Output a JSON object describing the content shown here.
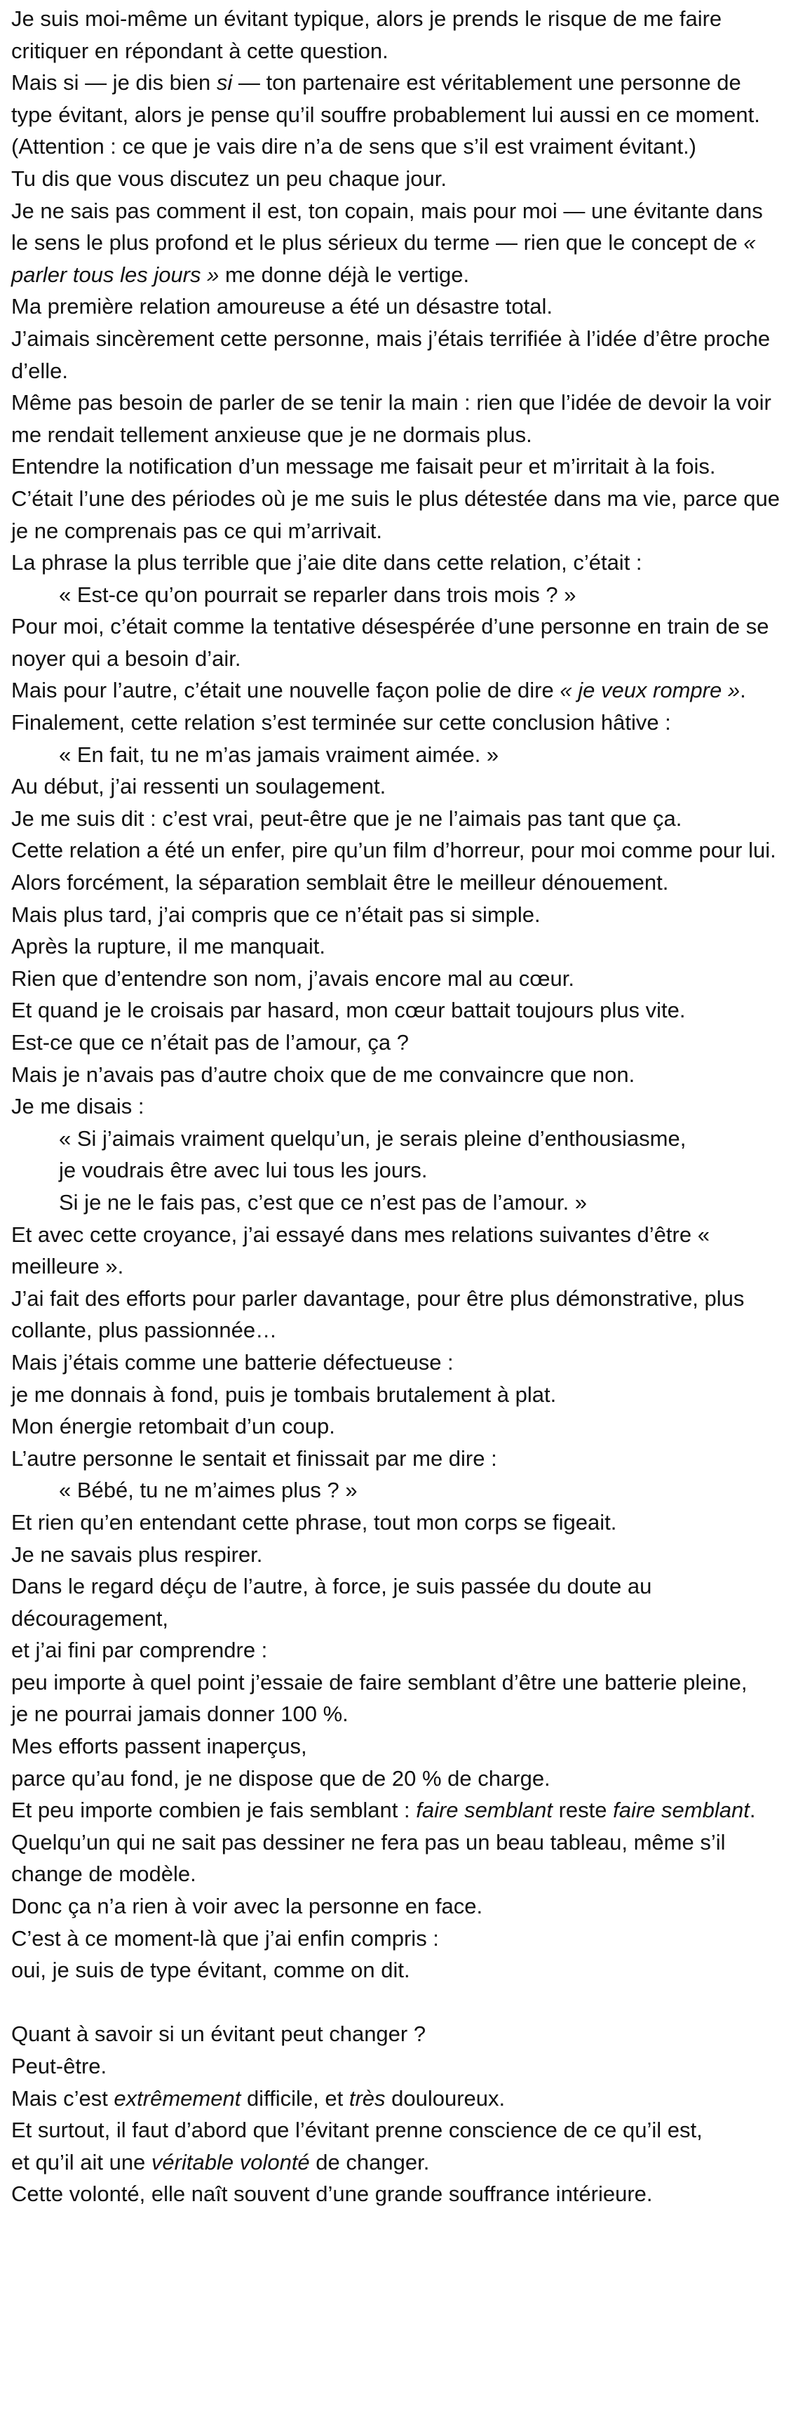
{
  "paragraphs": [
    {
      "id": "p1",
      "segments": [
        {
          "t": "Je suis moi-même un évitant typique, alors je prends le risque de me faire critiquer en répondant à cette question."
        }
      ]
    },
    {
      "id": "p2",
      "segments": [
        {
          "t": "Mais si — je dis bien "
        },
        {
          "t": "si",
          "i": true
        },
        {
          "t": " — ton partenaire est véritablement une personne de type évitant, alors je pense qu’il souffre probablement lui aussi en ce moment."
        }
      ]
    },
    {
      "id": "p3",
      "segments": [
        {
          "t": "(Attention : ce que je vais dire n’a de sens que s’il est vraiment évitant.)"
        }
      ]
    },
    {
      "id": "p4",
      "segments": [
        {
          "t": "Tu dis que vous discutez un peu chaque jour."
        }
      ]
    },
    {
      "id": "p5",
      "segments": [
        {
          "t": "Je ne sais pas comment il est, ton copain, mais pour moi — une évitante dans le sens le plus profond et le plus sérieux du terme — rien que le concept de "
        },
        {
          "t": "« parler tous les jours »",
          "i": true
        },
        {
          "t": " me donne déjà le vertige."
        }
      ]
    },
    {
      "id": "p6",
      "segments": [
        {
          "t": "Ma première relation amoureuse a été un désastre total."
        }
      ]
    },
    {
      "id": "p7",
      "segments": [
        {
          "t": "J’aimais sincèrement cette personne, mais j’étais terrifiée à l’idée d’être proche d’elle."
        }
      ]
    },
    {
      "id": "p8",
      "segments": [
        {
          "t": "Même pas besoin de parler de se tenir la main : rien que l’idée de devoir la voir me rendait tellement anxieuse que je ne dormais plus."
        }
      ]
    },
    {
      "id": "p9",
      "segments": [
        {
          "t": "Entendre la notification d’un message me faisait peur et m’irritait à la fois."
        }
      ]
    },
    {
      "id": "p10",
      "segments": [
        {
          "t": "C’était l’une des périodes où je me suis le plus détestée dans ma vie, parce que je ne comprenais pas ce qui m’arrivait."
        }
      ]
    },
    {
      "id": "p11",
      "segments": [
        {
          "t": "La phrase la plus terrible que j’aie dite dans cette relation, c’était :"
        }
      ]
    },
    {
      "id": "p12",
      "indent": true,
      "segments": [
        {
          "t": "« Est-ce qu’on pourrait se reparler dans trois mois ? »"
        }
      ]
    },
    {
      "id": "p13",
      "segments": [
        {
          "t": "Pour moi, c’était comme la tentative désespérée d’une personne en train de se noyer qui a besoin d’air."
        }
      ]
    },
    {
      "id": "p14",
      "segments": [
        {
          "t": "Mais pour l’autre, c’était une nouvelle façon polie de dire "
        },
        {
          "t": "« je veux rompre »",
          "i": true
        },
        {
          "t": "."
        }
      ]
    },
    {
      "id": "p15",
      "segments": [
        {
          "t": "Finalement, cette relation s’est terminée sur cette conclusion hâtive :"
        }
      ]
    },
    {
      "id": "p16",
      "indent": true,
      "segments": [
        {
          "t": "« En fait, tu ne m’as jamais vraiment aimée. »"
        }
      ]
    },
    {
      "id": "p17",
      "segments": [
        {
          "t": "Au début, j’ai ressenti un soulagement."
        }
      ]
    },
    {
      "id": "p18",
      "segments": [
        {
          "t": "Je me suis dit : c’est vrai, peut-être que je ne l’aimais pas tant que ça."
        }
      ]
    },
    {
      "id": "p19",
      "segments": [
        {
          "t": "Cette relation a été un enfer, pire qu’un film d’horreur, pour moi comme pour lui."
        }
      ]
    },
    {
      "id": "p20",
      "segments": [
        {
          "t": "Alors forcément, la séparation semblait être le meilleur dénouement."
        }
      ]
    },
    {
      "id": "p21",
      "segments": [
        {
          "t": "Mais plus tard, j’ai compris que ce n’était pas si simple."
        }
      ]
    },
    {
      "id": "p22",
      "segments": [
        {
          "t": "Après la rupture, il me manquait."
        }
      ]
    },
    {
      "id": "p23",
      "segments": [
        {
          "t": "Rien que d’entendre son nom, j’avais encore mal au cœur."
        }
      ]
    },
    {
      "id": "p24",
      "segments": [
        {
          "t": "Et quand je le croisais par hasard, mon cœur battait toujours plus vite."
        }
      ]
    },
    {
      "id": "p25",
      "segments": [
        {
          "t": "Est-ce que ce n’était pas de l’amour, ça ?"
        }
      ]
    },
    {
      "id": "p26",
      "segments": [
        {
          "t": "Mais je n’avais pas d’autre choix que de me convaincre que non."
        }
      ]
    },
    {
      "id": "p27",
      "segments": [
        {
          "t": "Je me disais :"
        }
      ]
    },
    {
      "id": "p28",
      "indent": true,
      "segments": [
        {
          "t": "« Si j’aimais vraiment quelqu’un, je serais pleine d’enthousiasme,"
        }
      ]
    },
    {
      "id": "p29",
      "indent": true,
      "segments": [
        {
          "t": "je voudrais être avec lui tous les jours."
        }
      ]
    },
    {
      "id": "p30",
      "indent": true,
      "segments": [
        {
          "t": "Si je ne le fais pas, c’est que ce n’est pas de l’amour. »"
        }
      ]
    },
    {
      "id": "p31",
      "segments": [
        {
          "t": "Et avec cette croyance, j’ai essayé dans mes relations suivantes d’être « meilleure »."
        }
      ]
    },
    {
      "id": "p32",
      "segments": [
        {
          "t": "J’ai fait des efforts pour parler davantage, pour être plus démonstrative, plus collante, plus passionnée…"
        }
      ]
    },
    {
      "id": "p33",
      "segments": [
        {
          "t": "Mais j’étais comme une batterie défectueuse :"
        }
      ]
    },
    {
      "id": "p34",
      "segments": [
        {
          "t": "je me donnais à fond, puis je tombais brutalement à plat."
        }
      ]
    },
    {
      "id": "p35",
      "segments": [
        {
          "t": "Mon énergie retombait d’un coup."
        }
      ]
    },
    {
      "id": "p36",
      "segments": [
        {
          "t": "L’autre personne le sentait et finissait par me dire :"
        }
      ]
    },
    {
      "id": "p37",
      "indent": true,
      "segments": [
        {
          "t": "« Bébé, tu ne m’aimes plus ? »"
        }
      ]
    },
    {
      "id": "p38",
      "segments": [
        {
          "t": "Et rien qu’en entendant cette phrase, tout mon corps se figeait."
        }
      ]
    },
    {
      "id": "p39",
      "segments": [
        {
          "t": "Je ne savais plus respirer."
        }
      ]
    },
    {
      "id": "p40",
      "segments": [
        {
          "t": "Dans le regard déçu de l’autre, à force, je suis passée du doute au découragement,"
        }
      ]
    },
    {
      "id": "p41",
      "segments": [
        {
          "t": "et j’ai fini par comprendre :"
        }
      ]
    },
    {
      "id": "p42",
      "segments": [
        {
          "t": "peu importe à quel point j’essaie de faire semblant d’être une batterie pleine,"
        }
      ]
    },
    {
      "id": "p43",
      "segments": [
        {
          "t": "je ne pourrai jamais donner 100 %."
        }
      ]
    },
    {
      "id": "p44",
      "segments": [
        {
          "t": "Mes efforts passent inaperçus,"
        }
      ]
    },
    {
      "id": "p45",
      "segments": [
        {
          "t": "parce qu’au fond, je ne dispose que de 20 % de charge."
        }
      ]
    },
    {
      "id": "p46",
      "segments": [
        {
          "t": "Et peu importe combien je fais semblant : "
        },
        {
          "t": "faire semblant",
          "i": true
        },
        {
          "t": " reste "
        },
        {
          "t": "faire semblant",
          "i": true
        },
        {
          "t": "."
        }
      ]
    },
    {
      "id": "p47",
      "segments": [
        {
          "t": "Quelqu’un qui ne sait pas dessiner ne fera pas un beau tableau, même s’il change de modèle."
        }
      ]
    },
    {
      "id": "p48",
      "segments": [
        {
          "t": "Donc ça n’a rien à voir avec la personne en face."
        }
      ]
    },
    {
      "id": "p49",
      "segments": [
        {
          "t": "C’est à ce moment-là que j’ai enfin compris :"
        }
      ]
    },
    {
      "id": "p50",
      "segments": [
        {
          "t": "oui, je suis de type évitant, comme on dit."
        }
      ]
    },
    {
      "id": "gap1",
      "blank": true,
      "segments": []
    },
    {
      "id": "p51",
      "segments": [
        {
          "t": "Quant à savoir si un évitant peut changer ?"
        }
      ]
    },
    {
      "id": "p52",
      "segments": [
        {
          "t": "Peut-être."
        }
      ]
    },
    {
      "id": "p53",
      "segments": [
        {
          "t": "Mais c’est "
        },
        {
          "t": "extrêmement",
          "i": true
        },
        {
          "t": " difficile, et "
        },
        {
          "t": "très",
          "i": true
        },
        {
          "t": " douloureux."
        }
      ]
    },
    {
      "id": "p54",
      "segments": [
        {
          "t": "Et surtout, il faut d’abord que l’évitant prenne conscience de ce qu’il est,"
        }
      ]
    },
    {
      "id": "p55",
      "segments": [
        {
          "t": "et qu’il ait une "
        },
        {
          "t": "véritable volonté",
          "i": true
        },
        {
          "t": " de changer."
        }
      ]
    },
    {
      "id": "p56",
      "segments": [
        {
          "t": "Cette volonté, elle naît souvent d’une grande souffrance intérieure."
        }
      ]
    }
  ]
}
